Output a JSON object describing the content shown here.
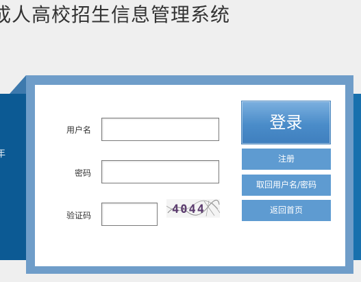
{
  "header": {
    "title": "成人高校招生信息管理系统"
  },
  "band": {
    "left_text": "年"
  },
  "form": {
    "username_label": "用户名",
    "username_value": "",
    "password_label": "密码",
    "password_value": "",
    "captcha_label": "验证码",
    "captcha_value": "",
    "captcha_image_text": "4044"
  },
  "buttons": {
    "login": "登录",
    "register": "注册",
    "recover": "取回用户名/密码",
    "home": "返回首页"
  },
  "colors": {
    "band": "#0c5a94",
    "frame": "#6f9dc9",
    "button": "#5e9bd1",
    "login_top": "#7cb0df",
    "login_bottom": "#3f7fbe"
  }
}
